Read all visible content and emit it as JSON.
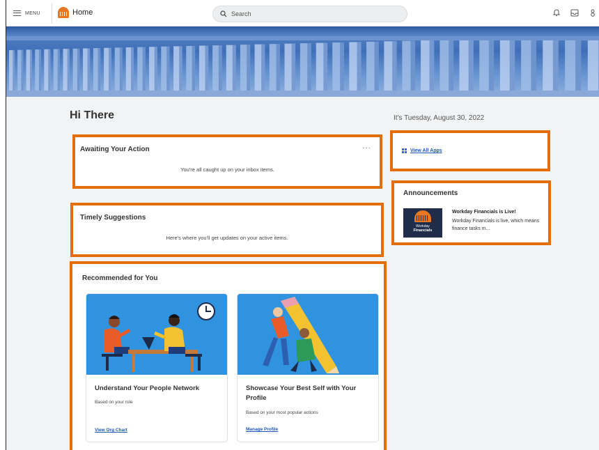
{
  "header": {
    "menu_label": "MENU",
    "home_label": "Home",
    "search_placeholder": "Search",
    "icons": [
      "bell-icon",
      "inbox-icon",
      "profile-icon"
    ]
  },
  "main": {
    "greeting": "Hi There",
    "date": "It's Tuesday, August 30, 2022"
  },
  "awaiting": {
    "title": "Awaiting Your Action",
    "more": "···",
    "message": "You're all caught up on your inbox items."
  },
  "timely": {
    "title": "Timely Suggestions",
    "message": "Here's where you'll get updates on your active items."
  },
  "apps": {
    "link": "View All Apps"
  },
  "announcements": {
    "title": "Announcements",
    "thumb_line1": "Workday",
    "thumb_line2": "Financials",
    "item_title": "Workday Financials is Live!",
    "item_body": "Workday Financials is live, which means finance tasks m..."
  },
  "recommended": {
    "title": "Recommended for You",
    "cards": [
      {
        "title": "Understand Your People Network",
        "subtitle": "Based on your role",
        "link": "View Org Chart"
      },
      {
        "title": "Showcase Your Best Self with Your Profile",
        "subtitle": "Based on your most popular actions",
        "link": "Manage Profile"
      }
    ]
  },
  "colors": {
    "highlight_border": "#e46d0c",
    "brand_orange": "#e87722",
    "link_blue": "#1f57b8",
    "banner_blue": "#3f6fb8",
    "illustration_blue": "#2f93e0"
  }
}
